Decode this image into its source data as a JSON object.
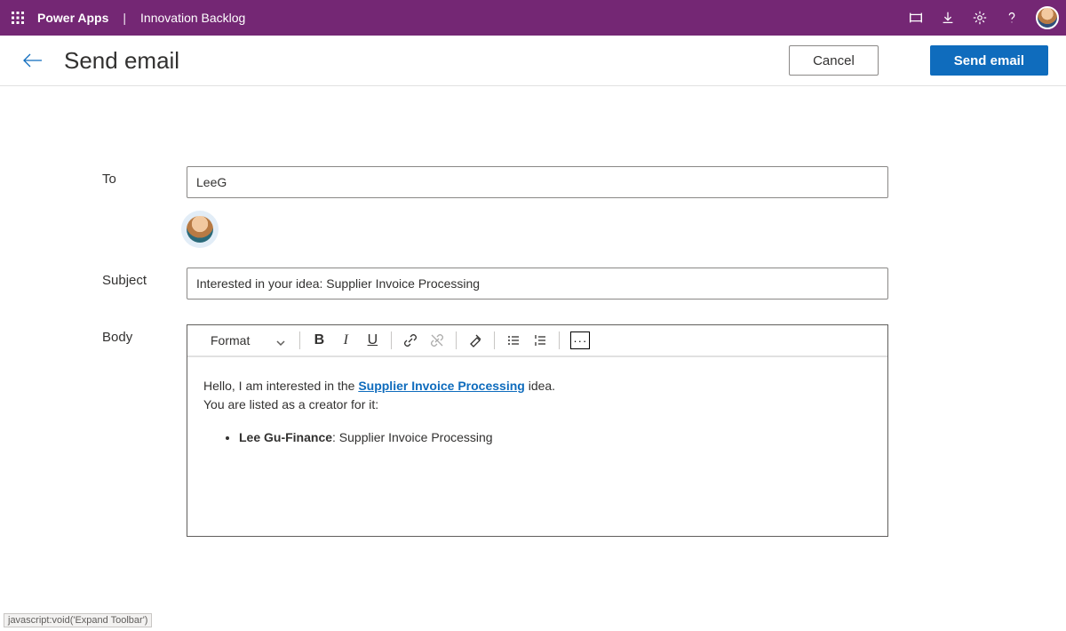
{
  "titlebar": {
    "brand": "Power Apps",
    "app_name": "Innovation Backlog"
  },
  "header": {
    "page_title": "Send email",
    "cancel_label": "Cancel",
    "send_label": "Send email"
  },
  "form": {
    "to_label": "To",
    "to_value": "LeeG",
    "subject_label": "Subject",
    "subject_value": "Interested in your idea: Supplier Invoice Processing",
    "body_label": "Body"
  },
  "toolbar": {
    "format_label": "Format",
    "bold": "B",
    "italic": "I",
    "underline": "U",
    "more": "···"
  },
  "body_content": {
    "line1_prefix": "Hello, I am interested in the ",
    "link_text": "Supplier Invoice Processing",
    "line1_suffix": " idea.",
    "line2": "You are listed as a creator for it:",
    "bullet_name": "Lee Gu-Finance",
    "bullet_suffix": ": Supplier Invoice Processing"
  },
  "status": "javascript:void('Expand Toolbar')"
}
